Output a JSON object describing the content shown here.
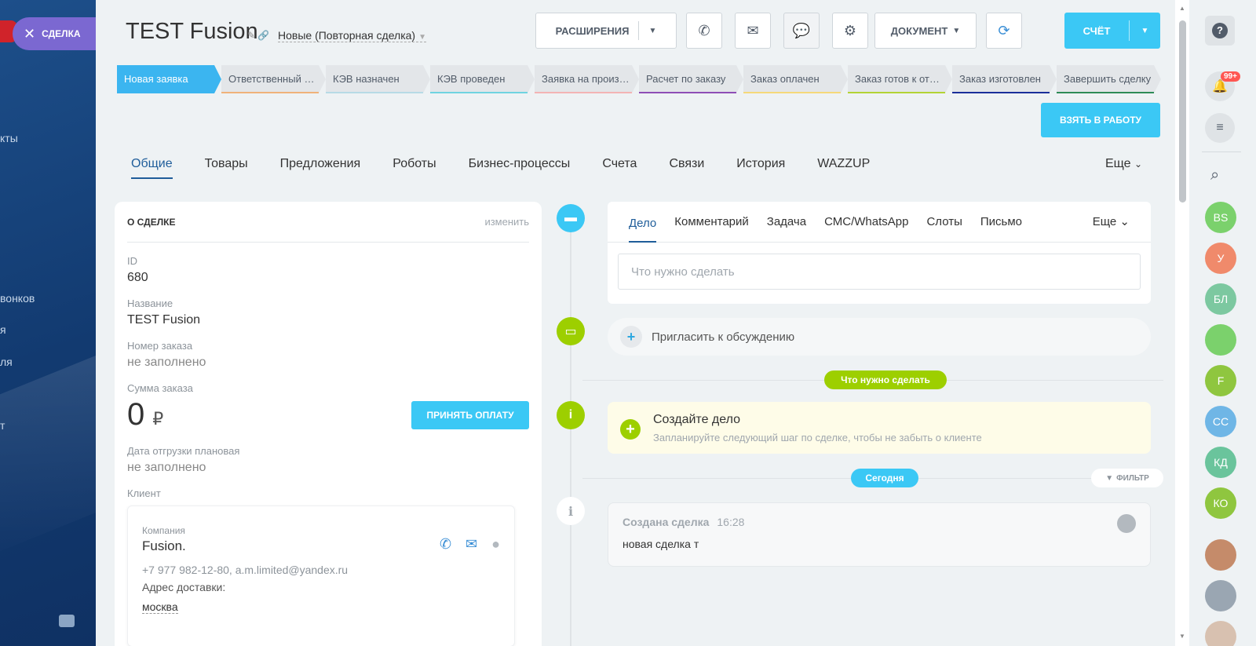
{
  "sidebar": {
    "deal_pill": "СДЕЛКА",
    "nav_fragments": [
      "кты",
      "вонков",
      "я",
      "ля",
      "т"
    ]
  },
  "header": {
    "title": "TEST Fusion",
    "stage": "Новые (Повторная сделка)",
    "extensions_label": "РАСШИРЕНИЯ",
    "document_label": "ДОКУМЕНТ",
    "invoice_label": "СЧЁТ",
    "take_to_work": "ВЗЯТЬ В РАБОТУ"
  },
  "stages": [
    {
      "label": "Новая заявка",
      "color": "#3bb5f0"
    },
    {
      "label": "Ответственный назначен",
      "color": "#f0b27a"
    },
    {
      "label": "КЭВ назначен",
      "color": "#b7dbe6"
    },
    {
      "label": "КЭВ проведен",
      "color": "#6fd3e0"
    },
    {
      "label": "Заявка на производство",
      "color": "#f3b4b4"
    },
    {
      "label": "Расчет по заказу",
      "color": "#8e4fb6"
    },
    {
      "label": "Заказ оплачен",
      "color": "#f5d97a"
    },
    {
      "label": "Заказ готов к отгрузке",
      "color": "#b3d335"
    },
    {
      "label": "Заказ изготовлен",
      "color": "#1a2f9a"
    },
    {
      "label": "Завершить сделку",
      "color": "#2e8b57"
    }
  ],
  "tabs": [
    "Общие",
    "Товары",
    "Предложения",
    "Роботы",
    "Бизнес-процессы",
    "Счета",
    "Связи",
    "История",
    "WAZZUP"
  ],
  "tabs_more": "Еще",
  "deal_card": {
    "header": "О СДЕЛКЕ",
    "edit": "изменить",
    "id_label": "ID",
    "id_value": "680",
    "name_label": "Название",
    "name_value": "TEST Fusion",
    "order_no_label": "Номер заказа",
    "order_no_value": "не заполнено",
    "sum_label": "Сумма заказа",
    "sum_value": "0",
    "currency": "₽",
    "pay_button": "ПРИНЯТЬ ОПЛАТУ",
    "ship_date_label": "Дата отгрузки плановая",
    "ship_date_value": "не заполнено",
    "client_label": "Клиент",
    "client": {
      "type": "Компания",
      "name": "Fusion.",
      "contacts": "+7 977 982-12-80, a.m.limited@yandex.ru",
      "address_label": "Адрес доставки:",
      "address": "москва"
    }
  },
  "activity": {
    "tabs": [
      "Дело",
      "Комментарий",
      "Задача",
      "СМС/WhatsApp",
      "Слоты",
      "Письмо"
    ],
    "more": "Еще",
    "input_placeholder": "Что нужно сделать",
    "invite": "Пригласить к обсуждению",
    "todo_pill": "Что нужно сделать",
    "todo_title": "Создайте дело",
    "todo_sub": "Запланируйте следующий шаг по сделке, чтобы не забыть о клиенте",
    "today_pill": "Сегодня",
    "filter": "ФИЛЬТР",
    "created_title": "Создана сделка",
    "created_time": "16:28",
    "created_body": "новая сделка т"
  },
  "right_sidebar": {
    "badge": "99+",
    "avatars": [
      {
        "initials": "BS",
        "color": "#7bd16c"
      },
      {
        "initials": "У",
        "color": "#f08a6b"
      },
      {
        "initials": "БЛ",
        "color": "#7cc8a0"
      },
      {
        "initials": "",
        "color": "#7bd16c"
      },
      {
        "initials": "F",
        "color": "#8fc63f"
      },
      {
        "initials": "СС",
        "color": "#6fb6e6"
      },
      {
        "initials": "КД",
        "color": "#6ac49c"
      },
      {
        "initials": "КО",
        "color": "#8fc63f"
      }
    ]
  }
}
